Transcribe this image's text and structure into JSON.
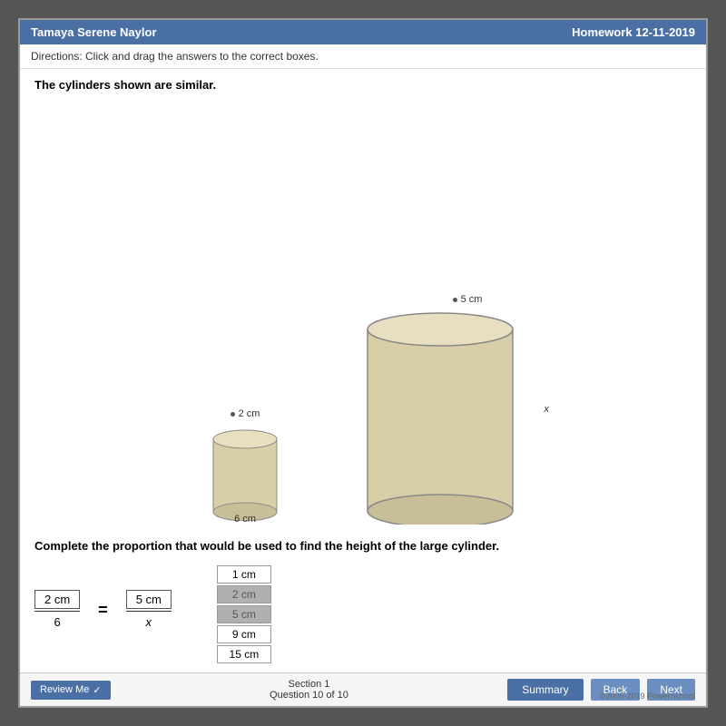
{
  "header": {
    "student_name": "Tamaya Serene Naylor",
    "assignment": "Homework 12-11-2019"
  },
  "directions": "Directions: Click and drag the answers to the correct boxes.",
  "problem": {
    "title": "The cylinders shown are similar.",
    "small_cylinder": {
      "radius_label": "2 cm",
      "height_label": "6 cm"
    },
    "large_cylinder": {
      "radius_label": "5 cm",
      "height_label": "x"
    },
    "question": "Complete the proportion that would be used to find the height of the large cylinder.",
    "proportion": {
      "numerator_left": "2 cm",
      "denominator_left": "6",
      "numerator_right": "5 cm",
      "denominator_right": "x"
    },
    "answer_choices": [
      {
        "value": "1 cm",
        "selected": false
      },
      {
        "value": "2 cm",
        "selected": true
      },
      {
        "value": "5 cm",
        "selected": true
      },
      {
        "value": "9 cm",
        "selected": false
      },
      {
        "value": "15 cm",
        "selected": false
      }
    ]
  },
  "footer": {
    "review_me_label": "Review Me",
    "section_label": "Section 1",
    "question_label": "Question 10 of 10",
    "summary_label": "Summary",
    "back_label": "Back",
    "next_label": "Next",
    "copyright": "©2005-2019 PowerSchool"
  }
}
